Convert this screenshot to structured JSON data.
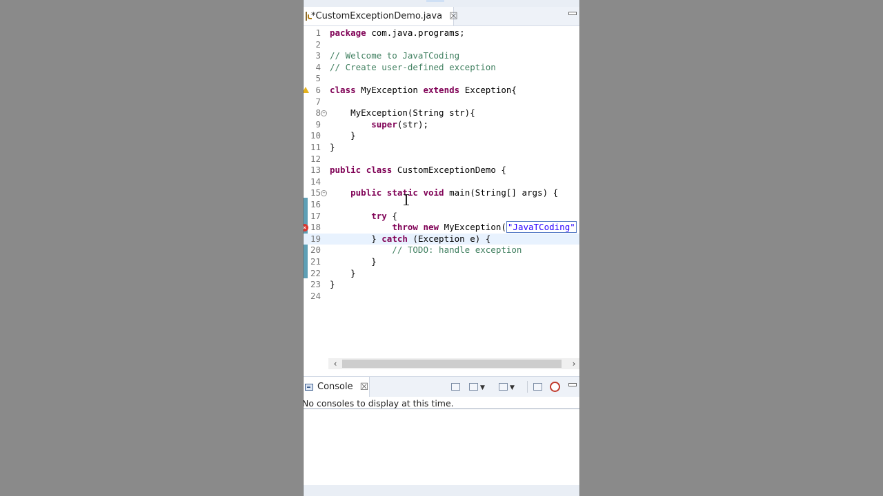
{
  "editor": {
    "tab_title": "*CustomExceptionDemo.java",
    "tab_close": "☒",
    "lines": [
      {
        "n": "1",
        "segments": [
          {
            "t": "package",
            "c": "kw"
          },
          {
            "t": " com.java.programs;",
            "c": "plain"
          }
        ]
      },
      {
        "n": "2",
        "segments": []
      },
      {
        "n": "3",
        "segments": [
          {
            "t": "// Welcome to JavaTCoding",
            "c": "cm"
          }
        ]
      },
      {
        "n": "4",
        "segments": [
          {
            "t": "// Create user-defined exception",
            "c": "cm"
          }
        ]
      },
      {
        "n": "5",
        "segments": []
      },
      {
        "n": "6",
        "marker": "warning",
        "segments": [
          {
            "t": "class",
            "c": "kw"
          },
          {
            "t": " MyException ",
            "c": "plain"
          },
          {
            "t": "extends",
            "c": "kw"
          },
          {
            "t": " Exception{",
            "c": "plain"
          }
        ]
      },
      {
        "n": "7",
        "segments": []
      },
      {
        "n": "8",
        "fold": true,
        "segments": [
          {
            "t": "    MyException(String str){",
            "c": "plain"
          }
        ]
      },
      {
        "n": "9",
        "segments": [
          {
            "t": "        ",
            "c": "plain"
          },
          {
            "t": "super",
            "c": "kw"
          },
          {
            "t": "(str);",
            "c": "plain"
          }
        ]
      },
      {
        "n": "10",
        "segments": [
          {
            "t": "    }",
            "c": "plain"
          }
        ]
      },
      {
        "n": "11",
        "segments": [
          {
            "t": "}",
            "c": "plain"
          }
        ]
      },
      {
        "n": "12",
        "segments": []
      },
      {
        "n": "13",
        "segments": [
          {
            "t": "public",
            "c": "kw"
          },
          {
            "t": " ",
            "c": "plain"
          },
          {
            "t": "class",
            "c": "kw"
          },
          {
            "t": " CustomExceptionDemo {",
            "c": "plain"
          }
        ]
      },
      {
        "n": "14",
        "segments": []
      },
      {
        "n": "15",
        "fold": true,
        "segments": [
          {
            "t": "    ",
            "c": "plain"
          },
          {
            "t": "public",
            "c": "kw"
          },
          {
            "t": " ",
            "c": "plain"
          },
          {
            "t": "static",
            "c": "kw"
          },
          {
            "t": " ",
            "c": "plain"
          },
          {
            "t": "void",
            "c": "kw"
          },
          {
            "t": " main(String[] args) {",
            "c": "plain"
          }
        ]
      },
      {
        "n": "16",
        "segments": []
      },
      {
        "n": "17",
        "segments": [
          {
            "t": "        ",
            "c": "plain"
          },
          {
            "t": "try",
            "c": "kw"
          },
          {
            "t": " {",
            "c": "plain"
          }
        ]
      },
      {
        "n": "18",
        "marker": "error",
        "segments": [
          {
            "t": "            ",
            "c": "plain"
          },
          {
            "t": "throw",
            "c": "kw"
          },
          {
            "t": " ",
            "c": "plain"
          },
          {
            "t": "new",
            "c": "kw"
          },
          {
            "t": " MyException(",
            "c": "plain"
          },
          {
            "t": "\"JavaTCoding\"",
            "c": "str"
          }
        ]
      },
      {
        "n": "19",
        "current": true,
        "segments": [
          {
            "t": "        } ",
            "c": "plain"
          },
          {
            "t": "catch",
            "c": "kw"
          },
          {
            "t": " (Exception e) {",
            "c": "plain"
          }
        ]
      },
      {
        "n": "20",
        "segments": [
          {
            "t": "            // TODO: handle exception",
            "c": "cm"
          }
        ]
      },
      {
        "n": "21",
        "segments": [
          {
            "t": "        }",
            "c": "plain"
          }
        ]
      },
      {
        "n": "22",
        "segments": [
          {
            "t": "    }",
            "c": "plain"
          }
        ]
      },
      {
        "n": "23",
        "segments": [
          {
            "t": "}",
            "c": "plain"
          }
        ]
      },
      {
        "n": "24",
        "segments": []
      }
    ]
  },
  "console": {
    "tab_title": "Console",
    "tab_close": "☒",
    "message": "No consoles to display at this time."
  },
  "colors": {
    "keyword": "#7f0055",
    "comment": "#3f7f5f",
    "string": "#2a00ff",
    "change_bar": "#5e9fb5"
  }
}
